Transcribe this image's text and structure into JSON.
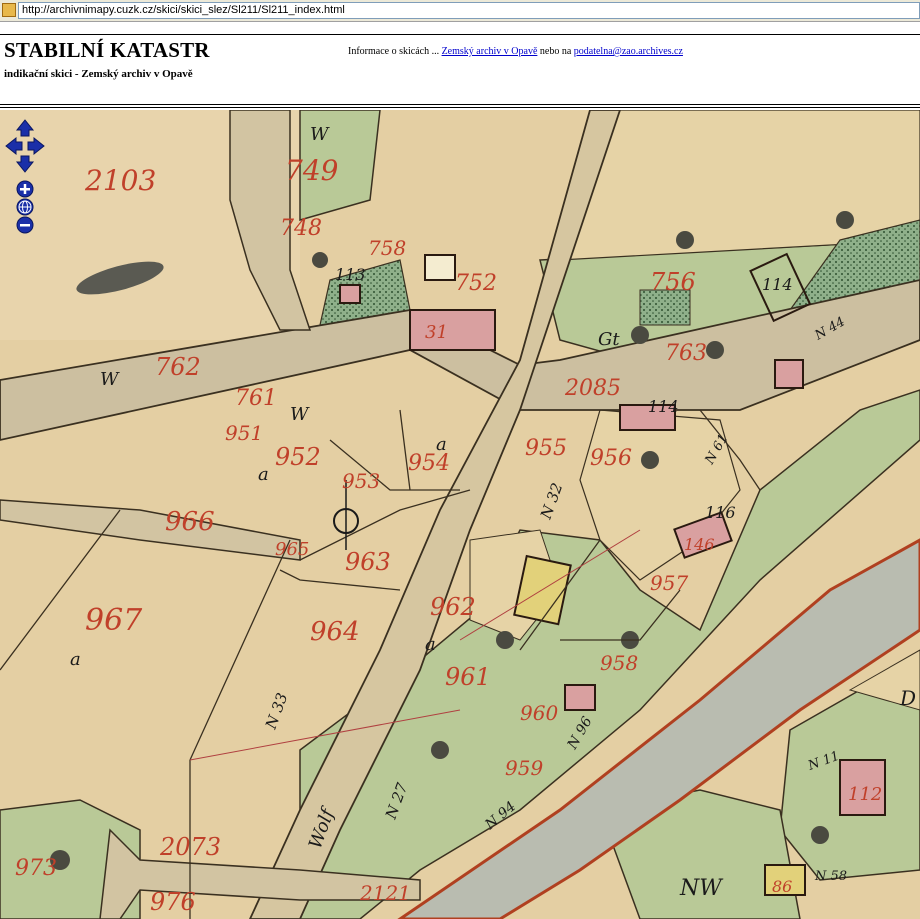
{
  "browser": {
    "url": "http://archivnimapy.cuzk.cz/skici/skici_slez/Sl211/Sl211_index.html"
  },
  "header": {
    "title": "STABILNÍ KATASTR",
    "subtitle": "indikační skici - Zemský archiv v Opavě",
    "info_prefix": "Informace o skicách ... ",
    "archive_link": "Zemský archiv v Opavě",
    "info_middle": " nebo na ",
    "email_link": "podatelna@zao.archives.cz"
  },
  "map": {
    "parcel_numbers": [
      "2103",
      "749",
      "748",
      "758",
      "762",
      "752",
      "756",
      "763",
      "2085",
      "761",
      "951",
      "952",
      "953",
      "954",
      "955",
      "956",
      "966",
      "963",
      "967",
      "964",
      "965",
      "962",
      "961",
      "960",
      "959",
      "957",
      "958",
      "2073",
      "976",
      "973",
      "2121",
      "31",
      "86",
      "146",
      "112",
      "114",
      "113",
      "116"
    ],
    "labels": [
      "W",
      "a",
      "Gt",
      "NW",
      "D",
      "Wolf",
      "N 33",
      "N 32",
      "N 27",
      "N 94",
      "N 96",
      "N 58",
      "N 11",
      "N 61",
      "N 44"
    ]
  },
  "controls": {
    "pan_up": "pan up",
    "pan_down": "pan down",
    "pan_left": "pan left",
    "pan_right": "pan right",
    "zoom_in": "+",
    "zoom_out": "−",
    "zoom_world": "world"
  }
}
